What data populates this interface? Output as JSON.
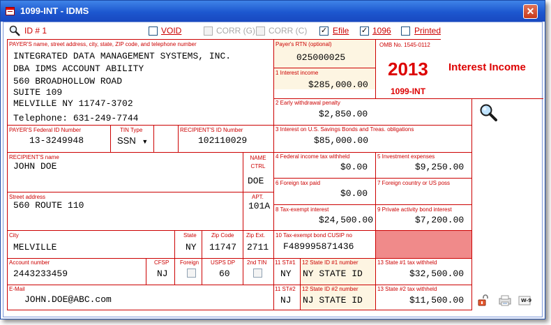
{
  "window": {
    "title": "1099-INT - IDMS",
    "close": "✕"
  },
  "toolbar": {
    "id_label": "ID # 1",
    "void": "VOID",
    "corr_g": "CORR (G)",
    "corr_c": "CORR (C)",
    "efile": "Efile",
    "form_1096": "1096",
    "printed": "Printed",
    "checks": {
      "void": false,
      "corr_g": false,
      "corr_c": false,
      "efile": true,
      "form_1096": true,
      "printed": false
    }
  },
  "payer": {
    "label": "PAYER'S name, street address, city, state, ZIP code, and telephone number",
    "lines": [
      "INTEGRATED DATA MANAGEMENT SYSTEMS, INC.",
      "DBA IDMS ACCOUNT ABILITY",
      "560 BROADHOLLOW ROAD",
      "SUITE 109",
      "MELVILLE NY 11747-3702"
    ],
    "telephone": "Telephone: 631-249-7744",
    "rtn_label": "Payer's RTN (optional)",
    "rtn": "025000025",
    "fed_id_label": "PAYER'S Federal ID Number",
    "fed_id": "13-3249948",
    "tin_type_label": "TIN Type",
    "tin_type": "SSN"
  },
  "header": {
    "omb": "OMB No. 1545-0112",
    "year": "2013",
    "form": "1099-INT",
    "title": "Interest Income"
  },
  "recipient": {
    "id_label": "RECIPIENT'S ID Number",
    "id": "102110029",
    "name_label": "RECIPIENT'S name",
    "name": "JOHN DOE",
    "name_ctrl_label": "NAME CTRL",
    "name_ctrl": "DOE",
    "street_label": "Street address",
    "street": "560 ROUTE 110",
    "apt_label": "APT.",
    "apt": "101A",
    "city_label": "City",
    "city": "MELVILLE",
    "state_label": "State",
    "state": "NY",
    "zip_label": "Zip Code",
    "zip": "11747",
    "zip_ext_label": "Zip Ext.",
    "zip_ext": "2711",
    "account_label": "Account number",
    "account": "2443233459",
    "cfsp_label": "CFSP",
    "cfsp": "NJ",
    "foreign_label": "Foreign",
    "usps_label": "USPS DP",
    "usps": "60",
    "tin2_label": "2nd TIN",
    "email_label": "E-Mail",
    "email": "JOHN.DOE@ABC.com"
  },
  "boxes": {
    "b1_label": "1 Interest income",
    "b1": "$285,000.00",
    "b2_label": "2 Early withdrawal penalty",
    "b2": "$2,850.00",
    "b3_label": "3 Interest on U.S. Savings Bonds and Treas. obligations",
    "b3": "$85,000.00",
    "b4_label": "4 Federal income tax withheld",
    "b4": "$0.00",
    "b5_label": "5 Investment expenses",
    "b5": "$9,250.00",
    "b6_label": "6 Foreign tax paid",
    "b6": "$0.00",
    "b7_label": "7 Foreign country or US poss",
    "b8_label": "8 Tax-exempt interest",
    "b8": "$24,500.00",
    "b9_label": "9 Private activity bond interest",
    "b9": "$7,200.00",
    "b10_label": "10 Tax-exempt bond CUSIP no",
    "b10": "F489995871436",
    "b11a_label": "11 ST#1",
    "b11a": "NY",
    "b12a_label": "12 State ID #1 number",
    "b12a": "NY STATE ID",
    "b13a_label": "13 State #1 tax withheld",
    "b13a": "$32,500.00",
    "b11b_label": "11 ST#2",
    "b11b": "NJ",
    "b12b_label": "12 State ID #2 number",
    "b12b": "NJ STATE ID",
    "b13b_label": "13 State #2 tax withheld",
    "b13b": "$11,500.00"
  },
  "colors": {
    "line": "#cc0000",
    "highlight": "#fdf5e2",
    "shaded": "#f08a8a"
  }
}
